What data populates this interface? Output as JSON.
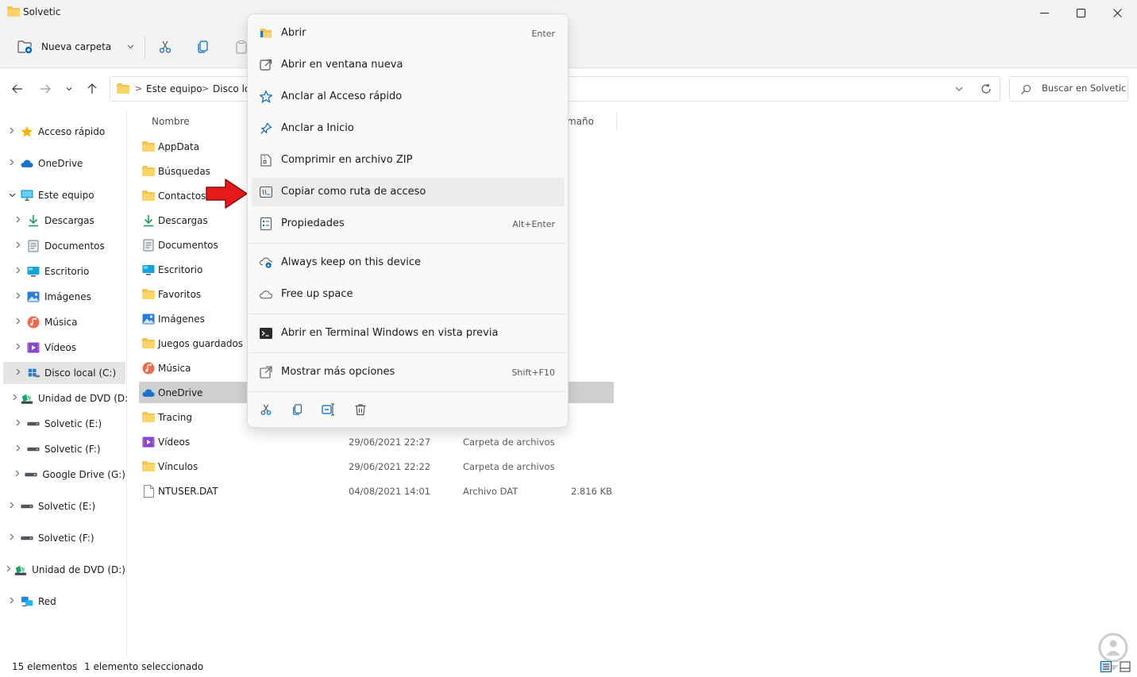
{
  "window": {
    "title": "Solvetic"
  },
  "commandbar": {
    "new_folder_label": "Nueva carpeta"
  },
  "address": {
    "crumbs": [
      "Este equipo",
      "Disco lo"
    ],
    "search_placeholder": "Buscar en Solvetic"
  },
  "columns": {
    "name": "Nombre",
    "size_partial": "maño"
  },
  "sidebar": {
    "items": [
      {
        "label": "Acceso rápido",
        "icon": "star-icon"
      },
      {
        "label": "OneDrive",
        "icon": "cloud-icon"
      },
      {
        "label": "Este equipo",
        "icon": "pc-icon"
      },
      {
        "label": "Descargas",
        "icon": "download-icon"
      },
      {
        "label": "Documentos",
        "icon": "document-icon"
      },
      {
        "label": "Escritorio",
        "icon": "desktop-icon"
      },
      {
        "label": "Imágenes",
        "icon": "pictures-icon"
      },
      {
        "label": "Música",
        "icon": "music-icon"
      },
      {
        "label": "Vídeos",
        "icon": "videos-icon"
      },
      {
        "label": "Disco local (C:)",
        "icon": "drive-icon"
      },
      {
        "label": "Unidad de DVD (D:",
        "icon": "dvd-icon"
      },
      {
        "label": "Solvetic (E:)",
        "icon": "usb-drive-icon"
      },
      {
        "label": "Solvetic (F:)",
        "icon": "usb-drive-icon"
      },
      {
        "label": "Google Drive (G:)",
        "icon": "usb-drive-icon"
      },
      {
        "label": "Solvetic (E:)",
        "icon": "usb-drive-icon"
      },
      {
        "label": "Solvetic (F:)",
        "icon": "usb-drive-icon"
      },
      {
        "label": "Unidad de DVD (D:)",
        "icon": "dvd-icon"
      },
      {
        "label": "Red",
        "icon": "network-icon"
      }
    ]
  },
  "files": [
    {
      "name": "AppData",
      "date": "",
      "type": "",
      "size": "",
      "icon": "folder-icon"
    },
    {
      "name": "Búsquedas",
      "date": "",
      "type": "",
      "size": "",
      "icon": "folder-icon"
    },
    {
      "name": "Contactos",
      "date": "",
      "type": "",
      "size": "",
      "icon": "folder-icon"
    },
    {
      "name": "Descargas",
      "date": "",
      "type": "",
      "size": "",
      "icon": "download-icon"
    },
    {
      "name": "Documentos",
      "date": "",
      "type": "",
      "size": "",
      "icon": "document-icon"
    },
    {
      "name": "Escritorio",
      "date": "",
      "type": "",
      "size": "",
      "icon": "desktop-icon"
    },
    {
      "name": "Favoritos",
      "date": "",
      "type": "",
      "size": "",
      "icon": "folder-icon"
    },
    {
      "name": "Imágenes",
      "date": "",
      "type": "",
      "size": "",
      "icon": "pictures-icon"
    },
    {
      "name": "Juegos guardados",
      "date": "",
      "type": "",
      "size": "",
      "icon": "folder-icon"
    },
    {
      "name": "Música",
      "date": "",
      "type": "",
      "size": "",
      "icon": "music-icon"
    },
    {
      "name": "OneDrive",
      "date": "",
      "type": "",
      "size": "",
      "icon": "cloud-icon"
    },
    {
      "name": "Tracing",
      "date": "",
      "type": "",
      "size": "",
      "icon": "folder-icon"
    },
    {
      "name": "Vídeos",
      "date": "29/06/2021 22:27",
      "type": "Carpeta de archivos",
      "size": "",
      "icon": "videos-icon"
    },
    {
      "name": "Vínculos",
      "date": "29/06/2021 22:22",
      "type": "Carpeta de archivos",
      "size": "",
      "icon": "folder-icon"
    },
    {
      "name": "NTUSER.DAT",
      "date": "04/08/2021 14:01",
      "type": "Archivo DAT",
      "size": "2.816 KB",
      "icon": "file-icon"
    }
  ],
  "context_menu": {
    "items": [
      {
        "label": "Abrir",
        "shortcut": "Enter",
        "icon": "open-folder-icon"
      },
      {
        "label": "Abrir en ventana nueva",
        "shortcut": "",
        "icon": "open-new-window-icon"
      },
      {
        "label": "Anclar al Acceso rápido",
        "shortcut": "",
        "icon": "star-outline-icon"
      },
      {
        "label": "Anclar a Inicio",
        "shortcut": "",
        "icon": "pin-icon"
      },
      {
        "label": "Comprimir en archivo ZIP",
        "shortcut": "",
        "icon": "zip-icon"
      },
      {
        "label": "Copiar como ruta de acceso",
        "shortcut": "",
        "icon": "copy-path-icon"
      },
      {
        "label": "Propiedades",
        "shortcut": "Alt+Enter",
        "icon": "properties-icon"
      },
      {
        "label": "Always keep on this device",
        "shortcut": "",
        "icon": "cloud-download-icon"
      },
      {
        "label": "Free up space",
        "shortcut": "",
        "icon": "cloud-outline-icon"
      },
      {
        "label": "Abrir en Terminal Windows en vista previa",
        "shortcut": "",
        "icon": "terminal-icon"
      },
      {
        "label": "Mostrar más opciones",
        "shortcut": "Shift+F10",
        "icon": "more-options-icon"
      }
    ],
    "quick_actions": [
      "cut-icon",
      "copy-icon",
      "rename-icon",
      "delete-icon"
    ]
  },
  "status": {
    "count": "15 elementos",
    "selection": "1 elemento seleccionado"
  },
  "colors": {
    "folder": "#f4c44e",
    "accent": "#0067c0",
    "arrow": "#e8191b"
  }
}
